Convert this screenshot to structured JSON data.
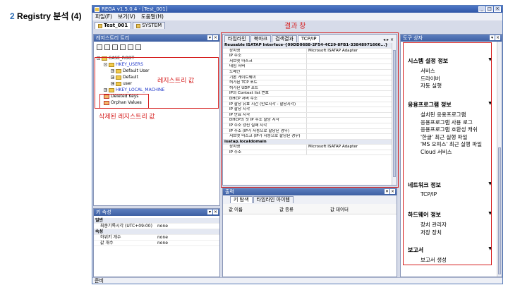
{
  "heading": {
    "num": "2",
    "title": " Registry 분석 (4)"
  },
  "window": {
    "title": "REGA v1.5.0.4 - [Test_001]"
  },
  "menu": [
    "파일(F)",
    "보기(V)",
    "도움말(H)"
  ],
  "doc_tabs": [
    {
      "label": "Test_001",
      "active": true
    },
    {
      "label": "SYSTEM",
      "active": false
    }
  ],
  "registry_tree": {
    "title": "레지스트리 트리",
    "nodes": [
      "CASE_ROOT",
      "HKEY_USERS",
      "Default User",
      "Default",
      "user",
      "HKEY_LOCAL_MACHINE",
      "Deleted Keys",
      "Orphan Values"
    ]
  },
  "annotations": {
    "registry_value": "레지스트리 값",
    "deleted_value": "삭제된 레지스트리 값",
    "result_window": "결과 창"
  },
  "result": {
    "tabs": [
      "타임라인",
      "북마크",
      "검색결과",
      "TCP/IP"
    ],
    "active_tab": 3,
    "rows": [
      {
        "type": "sec",
        "k": "Reusable ISATAP Interface-{09DD0688-2F54-4C29-8FB1-33848971666...}",
        "v": ""
      },
      {
        "k": "장치명",
        "v": "Microsoft ISATAP Adapter"
      },
      {
        "k": "IP 주소",
        "v": ""
      },
      {
        "k": "서브넷 마스크",
        "v": ""
      },
      {
        "k": "네임 서버",
        "v": ""
      },
      {
        "k": "도메인",
        "v": ""
      },
      {
        "k": "기본 게이트웨이",
        "v": ""
      },
      {
        "k": "허가된 TCP 포트",
        "v": ""
      },
      {
        "k": "허가된 UDP 포트",
        "v": ""
      },
      {
        "k": "IP의 Context list 번호",
        "v": ""
      },
      {
        "k": "DHCP 서버 주소",
        "v": ""
      },
      {
        "k": "IP 할당 유효 시간 (만료시각 - 할당시각)",
        "v": ""
      },
      {
        "k": "IP 할당 시각",
        "v": ""
      },
      {
        "k": "IP 만료 시각",
        "v": ""
      },
      {
        "k": "DHCP의 첫 IP 주소 할당 시각",
        "v": ""
      },
      {
        "k": "IP 주소 갱신 실패 시각",
        "v": ""
      },
      {
        "k": "IP 주소 (IP가 자동으로 할당된 경우)",
        "v": ""
      },
      {
        "k": "서브넷 마스크 (IP가 자동으로 할당된 경우)",
        "v": ""
      },
      {
        "type": "sec",
        "k": "isatap.localdomain",
        "v": ""
      },
      {
        "k": "장치명",
        "v": "Microsoft ISATAP Adapter"
      },
      {
        "k": "IP 주소",
        "v": ""
      }
    ]
  },
  "key_props": {
    "title": "키 속성",
    "rows": [
      {
        "type": "sec",
        "k": "일반",
        "v": ""
      },
      {
        "k": "최종기록시각 (UTC+09:00)",
        "v": "none"
      },
      {
        "type": "sec",
        "k": "속성",
        "v": ""
      },
      {
        "k": "하위키 개수",
        "v": "none"
      },
      {
        "k": "값 개수",
        "v": "none"
      }
    ]
  },
  "output": {
    "title": "출력",
    "tabs": [
      "키 탐색",
      "타임라인 아이템"
    ],
    "columns": [
      "값 이름",
      "값 종류",
      "값 데이터"
    ]
  },
  "toolbox": {
    "title": "도구 상자",
    "groups": [
      {
        "title": "시스템 설정 정보",
        "items": [
          "서비스",
          "드라이버",
          "자동 실행"
        ]
      },
      {
        "title": "응용프로그램 정보",
        "items": [
          "설치된 응용프로그램",
          "응용프로그램 사용 로그",
          "응용프로그램 호환성 캐쉬",
          "'한글' 최근 실행 파일",
          "'MS 오피스' 최근 실행 파일",
          "Cloud 서비스"
        ]
      },
      {
        "title": "네트워크 정보",
        "items": [
          "TCP/IP"
        ]
      },
      {
        "title": "하드웨어 정보",
        "items": [
          "장치 관리자",
          "저장 장치"
        ]
      },
      {
        "title": "보고서",
        "items": [
          "보고서 생성"
        ]
      }
    ]
  },
  "status": {
    "text": "준비"
  },
  "colors": {
    "annotation": "#d62020",
    "title_bar": "#3d5fa3",
    "heading_num": "#2e6db4"
  }
}
